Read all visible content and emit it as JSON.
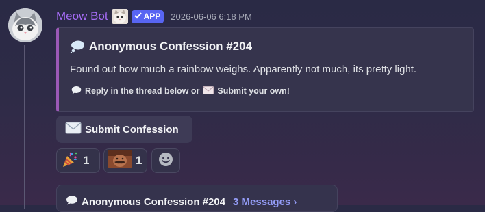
{
  "message": {
    "author": "Meow Bot",
    "badge": "APP",
    "timestamp": "2026-06-06 6:18 PM"
  },
  "embed": {
    "title": "Anonymous Confession #204",
    "description": "Found out how much a rainbow weighs. Apparently not much, its pretty light.",
    "footer_part1": "Reply in the thread below or",
    "footer_part2": "Submit your own!",
    "accent_color": "#9b59b6"
  },
  "button": {
    "label": "Submit Confession",
    "icon": "envelope-icon"
  },
  "reactions": [
    {
      "icon": "party-popper-icon",
      "count": "1"
    },
    {
      "icon": "custom-emote-icon",
      "count": "1"
    }
  ],
  "thread": {
    "title": "Anonymous Confession #204",
    "messages": "3 Messages ›"
  },
  "colors": {
    "author": "#a56cf5",
    "app_badge": "#5865f2",
    "link": "#949cf7"
  }
}
